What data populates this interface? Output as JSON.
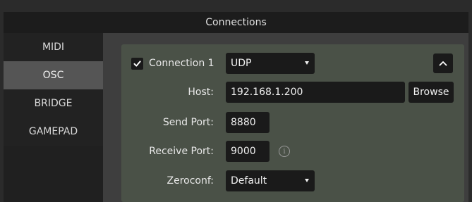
{
  "window": {
    "title": "Connections"
  },
  "sidebar": {
    "items": [
      {
        "label": "MIDI"
      },
      {
        "label": "OSC"
      },
      {
        "label": "BRIDGE"
      },
      {
        "label": "GAMEPAD"
      }
    ],
    "active": "OSC"
  },
  "connection": {
    "enabled": true,
    "label": "Connection 1",
    "protocol": "UDP",
    "collapse_icon": "chevron-up-icon",
    "host": {
      "label": "Host:",
      "value": "192.168.1.200",
      "browse_label": "Browse"
    },
    "send_port": {
      "label": "Send Port:",
      "value": "8880"
    },
    "receive_port": {
      "label": "Receive Port:",
      "value": "9000",
      "info_icon": "info-icon"
    },
    "zeroconf": {
      "label": "Zeroconf:",
      "value": "Default"
    }
  },
  "colors": {
    "panel": "#4a5147",
    "field": "#1a1a1a",
    "sidebar_active": "#555555"
  }
}
